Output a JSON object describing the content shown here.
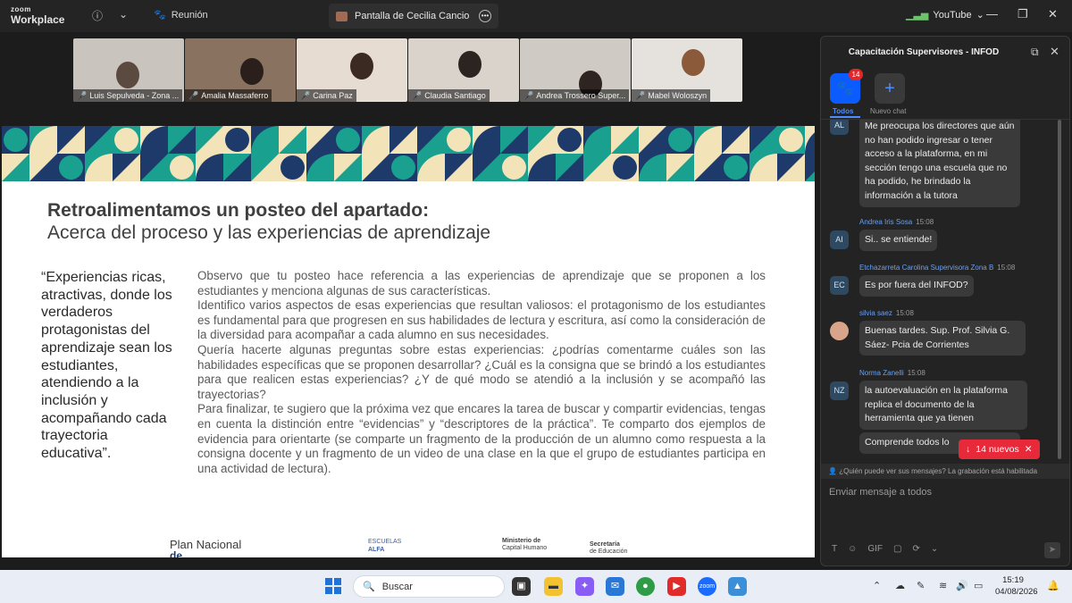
{
  "titlebar": {
    "brand_top": "zoom",
    "brand_bottom": "Workplace",
    "meeting_label": "Reunión",
    "share_label": "Pantalla de Cecilia Cancio",
    "youtube_label": "YouTube"
  },
  "participants": [
    {
      "name": "Luis Sepulveda - Zona ...",
      "bg": "#c9c4bd"
    },
    {
      "name": "Amalia Massaferro",
      "bg": "#8a7260"
    },
    {
      "name": "Carina Paz",
      "bg": "#e7dcd1"
    },
    {
      "name": "Claudia Santiago",
      "bg": "#d9d3cc"
    },
    {
      "name": "Andrea Trossero Super...",
      "bg": "#cfcac4"
    },
    {
      "name": "Mabel Woloszyn",
      "bg": "#e5e2de"
    }
  ],
  "slide": {
    "title": "Retroalimentamos un posteo del apartado:",
    "subtitle": "Acerca del proceso y las experiencias de aprendizaje",
    "quote": "“Experiencias ricas, atractivas, donde los verdaderos protagonistas del aprendizaje sean los estudiantes, atendiendo a la inclusión y acompañando cada trayectoria educativa”.",
    "paragraphs": [
      "Observo que tu posteo hace referencia a las experiencias de aprendizaje que se proponen a los estudiantes y menciona algunas de sus características.",
      "Identifico varios aspectos de esas experiencias que resultan valiosos: el protagonismo de los estudiantes es fundamental para que progresen en sus habilidades de lectura y escritura, así como la consideración de la diversidad para acompañar a cada alumno en sus necesidades.",
      "Quería hacerte algunas preguntas sobre estas experiencias: ¿podrías comentarme cuáles son las habilidades específicas que se proponen desarrollar? ¿Cuál es la consigna que se brindó a los estudiantes para que realicen estas experiencias? ¿Y de qué modo se atendió a la inclusión y se acompañó las trayectorias?",
      "Para finalizar, te sugiero que la próxima vez que encares la tarea de buscar y compartir evidencias, tengas en cuenta la distinción entre “evidencias” y “descriptores de la práctica”. Te comparto dos ejemplos de evidencia para orientarte (se comparte un fragmento de la producción de un alumno como respuesta a la consigna docente y un fragmento de un video de una clase en la que el grupo de estudiantes participa en una actividad de lectura)."
    ],
    "footer": {
      "plan_line1": "Plan Nacional",
      "plan_line2": "de Alfabetización",
      "escuelas_line1": "ESCUELAS",
      "escuelas_line2": "ALFA",
      "ministerio_line1": "Ministerio de",
      "ministerio_line2": "Capital Humano",
      "secretaria_line1": "Secretaría",
      "secretaria_line2": "de Educación"
    }
  },
  "chat": {
    "title": "Capacitación Supervisores - INFOD",
    "tab_all_label": "Todos",
    "tab_all_badge": "14",
    "tab_new_label": "Nuevo chat",
    "messages": [
      {
        "initials": "AL",
        "sender": "",
        "time": "",
        "text": "Me preocupa los directores que aún no han podido ingresar o tener acceso a la plataforma, en mi sección tengo una escuela que no ha podido, he brindado la información a la tutora"
      },
      {
        "initials": "AI",
        "sender": "Andrea Iris Sosa",
        "time": "15:08",
        "text": "Si.. se entiende!"
      },
      {
        "initials": "EC",
        "sender": "Etchazarreta Carolina Supervisora Zona B",
        "time": "15:08",
        "text": "Es por fuera del INFOD?"
      },
      {
        "initials": "",
        "sender": "silvia saez",
        "time": "15:08",
        "text": "Buenas tardes. Sup. Prof. Silvia G. Sáez- Pcia de Corrientes"
      },
      {
        "initials": "NZ",
        "sender": "Norma Zanelli",
        "time": "15:08",
        "text": "la autoevaluación en la plataforma replica el documento de la herramienta que ya tienen"
      },
      {
        "initials": "",
        "sender": "",
        "time": "",
        "text": "Comprende todos lo"
      }
    ],
    "new_messages_label": "14 nuevos",
    "privacy_notice": "¿Quién puede ver sus mensajes? La grabación está habilitada",
    "input_placeholder": "Enviar mensaje a todos",
    "tools": [
      "T",
      "☺",
      "GIF",
      "▢",
      "⟳",
      "⌄"
    ]
  },
  "taskbar": {
    "search_label": "Buscar",
    "time": "15:19",
    "date": "04/08/2026"
  }
}
